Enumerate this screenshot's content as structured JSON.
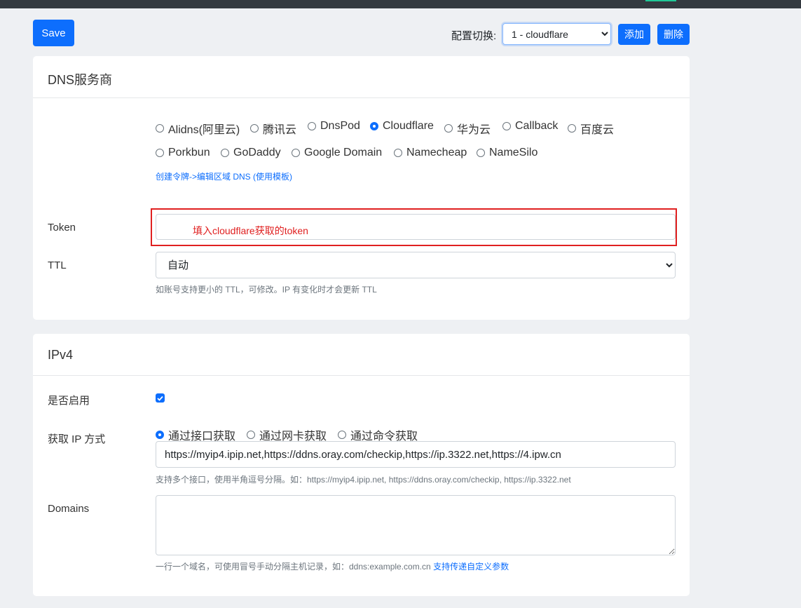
{
  "toolbar": {
    "save_label": "Save",
    "config_label": "配置切换:",
    "config_selected": "1 - cloudflare",
    "add_label": "添加",
    "delete_label": "删除"
  },
  "dns_card": {
    "title": "DNS服务商",
    "providers": [
      {
        "label": "Alidns(阿里云)",
        "checked": false
      },
      {
        "label": "腾讯云",
        "checked": false
      },
      {
        "label": "DnsPod",
        "checked": false
      },
      {
        "label": "Cloudflare",
        "checked": true
      },
      {
        "label": "华为云",
        "checked": false
      },
      {
        "label": "Callback",
        "checked": false
      },
      {
        "label": "百度云",
        "checked": false
      },
      {
        "label": "Porkbun",
        "checked": false
      },
      {
        "label": "GoDaddy",
        "checked": false
      },
      {
        "label": "Google Domain",
        "checked": false
      },
      {
        "label": "Namecheap",
        "checked": false
      },
      {
        "label": "NameSilo",
        "checked": false
      }
    ],
    "help_link": "创建令牌->编辑区域 DNS (使用模板)",
    "token_label": "Token",
    "token_hint": "填入cloudflare获取的token",
    "ttl_label": "TTL",
    "ttl_selected": "自动",
    "ttl_help": "如账号支持更小的 TTL，可修改。IP 有变化时才会更新 TTL"
  },
  "ipv4_card": {
    "title": "IPv4",
    "enable_label": "是否启用",
    "enabled": true,
    "method_label": "获取 IP 方式",
    "methods": [
      {
        "label": "通过接口获取",
        "checked": true
      },
      {
        "label": "通过网卡获取",
        "checked": false
      },
      {
        "label": "通过命令获取",
        "checked": false
      }
    ],
    "url_value": "https://myip4.ipip.net,https://ddns.oray.com/checkip,https://ip.3322.net,https://4.ipw.cn",
    "url_help": "支持多个接口，使用半角逗号分隔。如：https://myip4.ipip.net, https://ddns.oray.com/checkip, https://ip.3322.net",
    "domains_label": "Domains",
    "domains_value": "",
    "domains_help": "一行一个域名，可使用冒号手动分隔主机记录，如：ddns:example.com.cn",
    "domains_help_link": "支持传递自定义参数"
  },
  "colors": {
    "primary": "#0d6efd",
    "highlight": "#e02020",
    "topbar": "#343a40"
  }
}
